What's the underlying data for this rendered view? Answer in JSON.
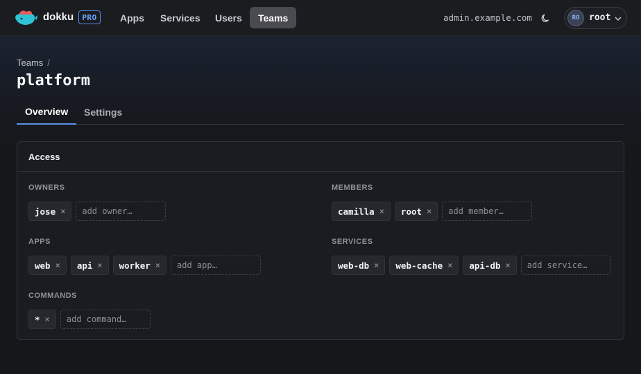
{
  "nav": {
    "brand": "dokku",
    "badge": "PRO",
    "links": [
      {
        "label": "Apps"
      },
      {
        "label": "Services"
      },
      {
        "label": "Users"
      },
      {
        "label": "Teams",
        "active": true
      }
    ],
    "host": "admin.example.com",
    "theme_icon": "moon-icon",
    "user": {
      "initials": "RO",
      "name": "root"
    }
  },
  "breadcrumb": {
    "parent": "Teams",
    "separator": "/"
  },
  "page_title": "platform",
  "tabs": [
    {
      "label": "Overview",
      "active": true
    },
    {
      "label": "Settings"
    }
  ],
  "access": {
    "title": "Access",
    "owners": {
      "label": "OWNERS",
      "items": [
        "jose"
      ],
      "placeholder": "add owner…"
    },
    "members": {
      "label": "MEMBERS",
      "items": [
        "camilla",
        "root"
      ],
      "placeholder": "add member…"
    },
    "apps": {
      "label": "APPS",
      "items": [
        "web",
        "api",
        "worker"
      ],
      "placeholder": "add app…"
    },
    "services": {
      "label": "SERVICES",
      "items": [
        "web-db",
        "web-cache",
        "api-db"
      ],
      "placeholder": "add service…"
    },
    "commands": {
      "label": "COMMANDS",
      "items": [
        "*"
      ],
      "placeholder": "add command…"
    }
  },
  "colors": {
    "accent": "#5b93e6",
    "badge": "#6aa7ff",
    "logo": "#2ec4d6"
  }
}
